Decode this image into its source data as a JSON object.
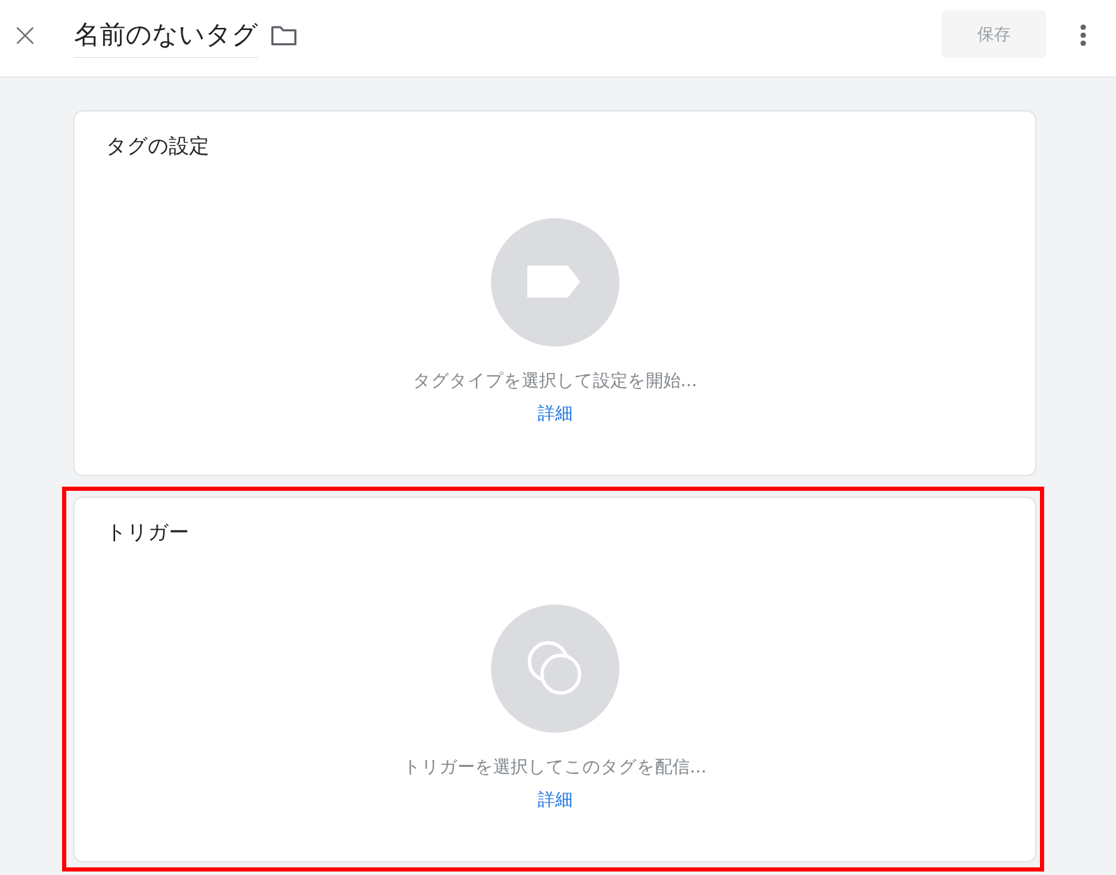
{
  "header": {
    "name_field": {
      "value": "名前のないタグ"
    },
    "save_button": {
      "label": "保存",
      "disabled": true
    }
  },
  "sections": [
    {
      "kind": "tag",
      "title": "タグの設定",
      "prompt": "タグタイプを選択して設定を開始...",
      "link": "詳細",
      "highlighted": false
    },
    {
      "kind": "trigger",
      "title": "トリガー",
      "prompt": "トリガーを選択してこのタグを配信...",
      "link": "詳細",
      "highlighted": true
    }
  ]
}
